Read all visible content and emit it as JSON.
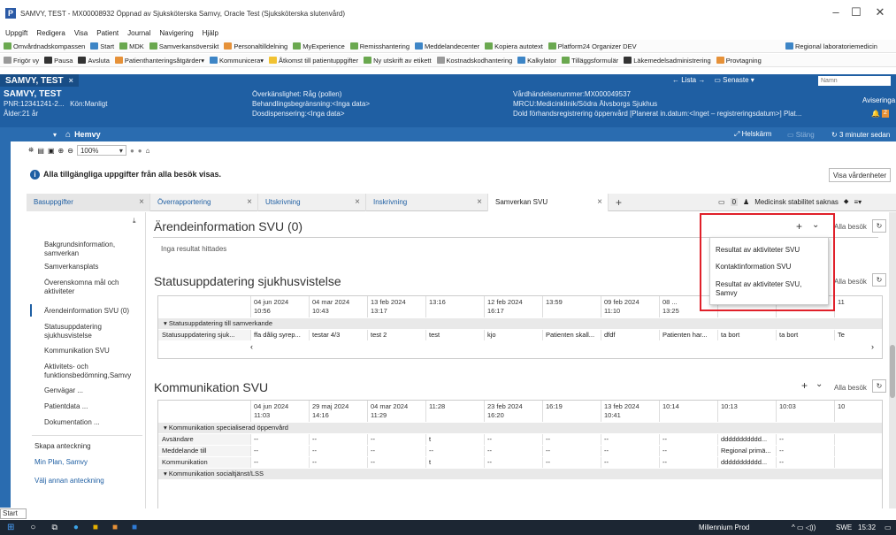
{
  "window": {
    "title": "SAMVY, TEST - MX00008932 Öppnad av Sjuksköterska Samvy, Oracle Test (Sjuksköterska slutenvård)",
    "controls": [
      "–",
      "☐",
      "✕"
    ]
  },
  "menubar": [
    "Uppgift",
    "Redigera",
    "Visa",
    "Patient",
    "Journal",
    "Navigering",
    "Hjälp"
  ],
  "toolbar1": [
    "Omvårdnadskompassen",
    "Start",
    "MDK",
    "Samverkansöversikt",
    "Personaltilldelning",
    "MyExperience",
    "Remisshantering",
    "Meddelandecenter",
    "Kopiera autotext",
    "Platform24 Organizer DEV",
    "Regional laboratoriemedicin"
  ],
  "toolbar2": [
    "Frigör vy",
    "Pausa",
    "Avsluta",
    "Patienthanteringsåtgärder",
    "Kommunicera",
    "Åtkomst till patientuppgifter",
    "Ny utskrift av etikett",
    "Kostnadskodhantering",
    "Kalkylator",
    "Tilläggsformulär",
    "Läkemedelsadministrering",
    "Provtagning"
  ],
  "patient_tab": {
    "name": "SAMVY, TEST",
    "close": "×"
  },
  "nav_right": {
    "lista": "Lista",
    "senaste": "Senaste",
    "search_placeholder": "Namn"
  },
  "banner": {
    "name": "SAMVY, TEST",
    "pnr": "PNR:12341241-2...",
    "gender": "Kön:Manligt",
    "age": "Ålder:21 år",
    "col2": [
      "Överkänslighet: Råg (pollen)",
      "Behandlingsbegränsning:<Inga data>",
      "Dosdispensering:<Inga data>"
    ],
    "col3": [
      "Vårdhändelsenummer:MX000049537",
      "MRCU:Medicinklinik/Södra Älvsborgs Sjukhus",
      "Dold förhandsregistrering öppenvård [Planerat in.datum:<Inget – registreringsdatum>] Plat..."
    ],
    "aviseringar": "Aviseringa",
    "badge1": "4",
    "badge2": "2"
  },
  "navbar": {
    "home": "Hemvy",
    "fullscreen": "Helskärm",
    "stang": "Stäng",
    "refresh": "3 minuter sedan"
  },
  "toolrow": {
    "zoom": "100%"
  },
  "infobar": {
    "message": "Alla tillgängliga uppgifter från alla besök visas.",
    "button": "Visa vårdenheter"
  },
  "tabs": [
    {
      "label": "Basuppgifter",
      "close": "×"
    },
    {
      "label": "Överrapportering",
      "close": "×"
    },
    {
      "label": "Utskrivning",
      "close": "×"
    },
    {
      "label": "Inskrivning",
      "close": "×"
    },
    {
      "label": "Samverkan SVU",
      "close": "×"
    }
  ],
  "tab_add": "+",
  "tab_right": {
    "badge": "0",
    "stability": "Medicinsk stabilitet saknas"
  },
  "leftnav": {
    "pin": "⤓",
    "items": [
      "Bakgrundsinformation, samverkan",
      "Samverkansplats",
      "Överenskomna mål och aktiviteter",
      "Ärendeinformation SVU (0)",
      "Statusuppdatering sjukhusvistelse",
      "Kommunikation SVU",
      "Aktivitets- och funktionsbedömning,Samvy",
      "Genvägar ...",
      "Patientdata ...",
      "Dokumentation ..."
    ],
    "links": [
      "Skapa anteckning",
      "Min Plan, Samvy",
      "Välj annan anteckning"
    ]
  },
  "sec1": {
    "title": "Ärendeinformation SVU (0)",
    "empty": "Inga resultat hittades",
    "filter": "Alla besök",
    "plus": "+",
    "chevron": "⌄"
  },
  "dropdown": [
    "Resultat av aktiviteter SVU",
    "Kontaktinformation SVU",
    "Resultat av aktiviteter SVU, Samvy"
  ],
  "sec2": {
    "title": "Statusuppdatering sjukhusvistelse",
    "filter": "Alla besök",
    "headers": [
      [
        "04 jun 2024",
        "10:56"
      ],
      [
        "04 mar 2024",
        "10:43"
      ],
      [
        "13 feb 2024",
        "13:17"
      ],
      [
        "",
        "13:16"
      ],
      [
        "12 feb 2024",
        "16:17"
      ],
      [
        "",
        "13:59"
      ],
      [
        "09 feb 2024",
        "11:10"
      ],
      [
        "08 ...",
        "13:25"
      ],
      [
        "",
        "11:19"
      ],
      [
        "",
        "11:18"
      ],
      [
        "",
        "11"
      ]
    ],
    "group": "Statusuppdatering till samverkande",
    "row_label": "Statusuppdatering sjuk...",
    "row": [
      "ffa dålig syrep...",
      "testar 4/3",
      "test 2",
      "test",
      "kjo",
      "Patienten skall...",
      "dfdf",
      "Patienten har...",
      "ta bort",
      "ta bort",
      "Te"
    ]
  },
  "sec3": {
    "title": "Kommunikation SVU",
    "filter": "Alla besök",
    "headers": [
      [
        "04 jun 2024",
        "11:03"
      ],
      [
        "29 maj 2024",
        "14:16"
      ],
      [
        "04 mar 2024",
        "11:29"
      ],
      [
        "",
        "11:28"
      ],
      [
        "23 feb 2024",
        "16:20"
      ],
      [
        "",
        "16:19"
      ],
      [
        "13 feb 2024",
        "10:41"
      ],
      [
        "",
        "10:14"
      ],
      [
        "",
        "10:13"
      ],
      [
        "",
        "10:03"
      ],
      [
        "",
        "10"
      ]
    ],
    "group1": "Kommunikation specialiserad öppenvård",
    "rows": [
      {
        "label": "Avsändare",
        "cells": [
          "--",
          "--",
          "--",
          "t",
          "--",
          "--",
          "--",
          "--",
          "ddddddddddd...",
          "--",
          ""
        ]
      },
      {
        "label": "Meddelande till",
        "cells": [
          "--",
          "--",
          "--",
          "--",
          "--",
          "--",
          "--",
          "--",
          "Regional primä...",
          "--",
          ""
        ]
      },
      {
        "label": "Kommunikation",
        "cells": [
          "--",
          "--",
          "--",
          "t",
          "--",
          "--",
          "--",
          "--",
          "ddddddddddd...",
          "--",
          ""
        ]
      }
    ],
    "group2": "Kommunikation socialtjänst/LSS"
  },
  "start_label": "Start",
  "taskbar": {
    "env": "Millennium Prod",
    "lang": "SWE",
    "time": "15:32"
  },
  "colors": {
    "banner": "#1f5fa3",
    "nav": "#2a6cb0",
    "highlight": "#e0202a"
  }
}
